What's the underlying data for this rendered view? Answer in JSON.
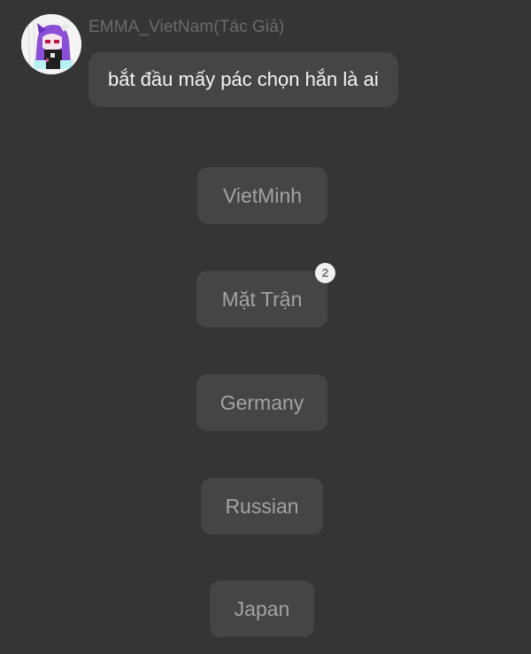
{
  "message": {
    "author": "EMMA_VietNam(Tác Giả)",
    "text": "bắt đầu mấy pác chọn hắn là ai",
    "avatar_icon": "anime-character-avatar"
  },
  "choices": [
    {
      "label": "VietMinh"
    },
    {
      "label": "Mặt Trận",
      "badge": "2"
    },
    {
      "label": "Germany"
    },
    {
      "label": "Russian"
    },
    {
      "label": "Japan"
    }
  ],
  "colors": {
    "background": "#353535",
    "bubble": "#454545",
    "choice_text": "#a3a3a3",
    "author_text": "#6b6b6b",
    "badge_bg": "#f0f0f0"
  }
}
